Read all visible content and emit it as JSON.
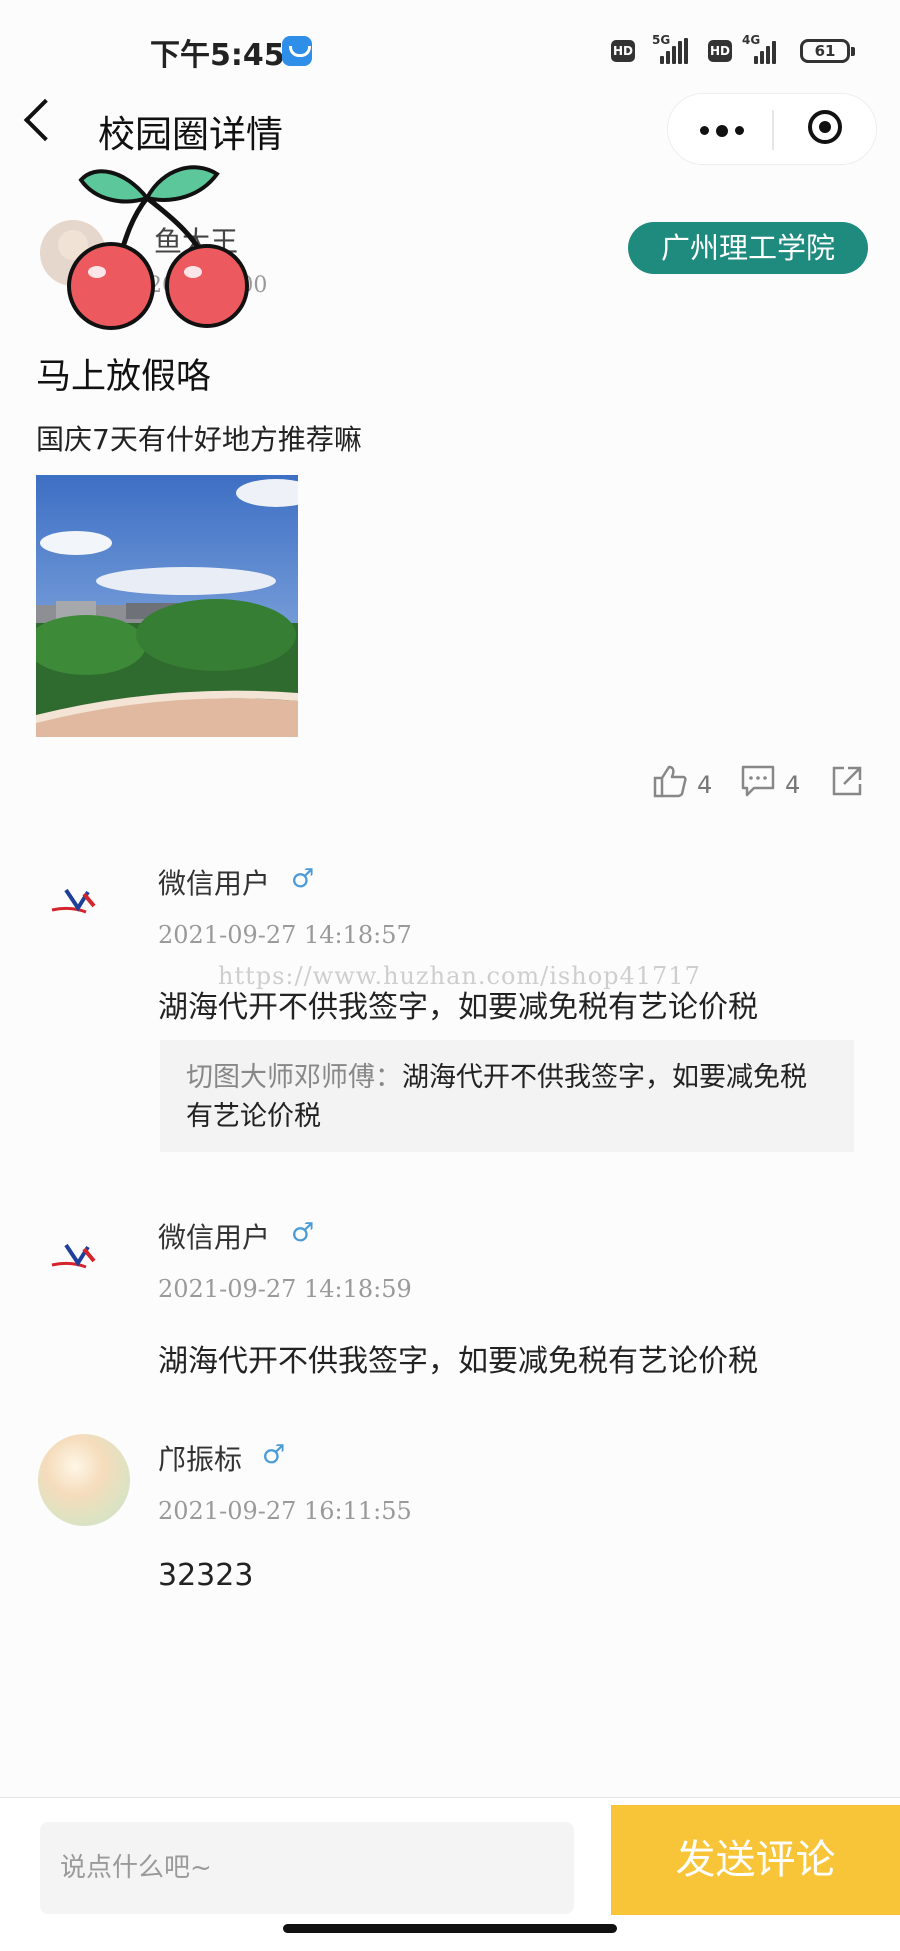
{
  "status_bar": {
    "time": "下午5:45",
    "hd1": "HD",
    "net1": "5G",
    "hd2": "HD",
    "net2": "4G",
    "battery": "61"
  },
  "nav": {
    "title": "校园圈详情"
  },
  "post": {
    "author_name": "鱼大王",
    "time": "20 7 11:00",
    "school_tag": "广州理工学院",
    "title": "马上放假咯",
    "body": "国庆7天有什好地方推荐嘛",
    "like_count": "4",
    "comment_count": "4"
  },
  "watermark": "https://www.huzhan.com/ishop41717",
  "comments": [
    {
      "name": "微信用户",
      "gender": "♂",
      "time": "2021-09-27 14:18:57",
      "text": "湖海代开不供我签字，如要减免税有艺论价税",
      "reply": {
        "author": "切图大师邓师傅：",
        "text": "湖海代开不供我签字，如要减免税有艺论价税"
      }
    },
    {
      "name": "微信用户",
      "gender": "♂",
      "time": "2021-09-27 14:18:59",
      "text": "湖海代开不供我签字，如要减免税有艺论价税"
    },
    {
      "name": "邝振标",
      "gender": "♂",
      "time": "2021-09-27 16:11:55",
      "text": "32323"
    }
  ],
  "input": {
    "placeholder": "说点什么吧~"
  },
  "send_button": "发送评论",
  "colors": {
    "accent_teal": "#1f8a7e",
    "send_yellow": "#f7c537",
    "gender_blue": "#4a9bd8"
  }
}
